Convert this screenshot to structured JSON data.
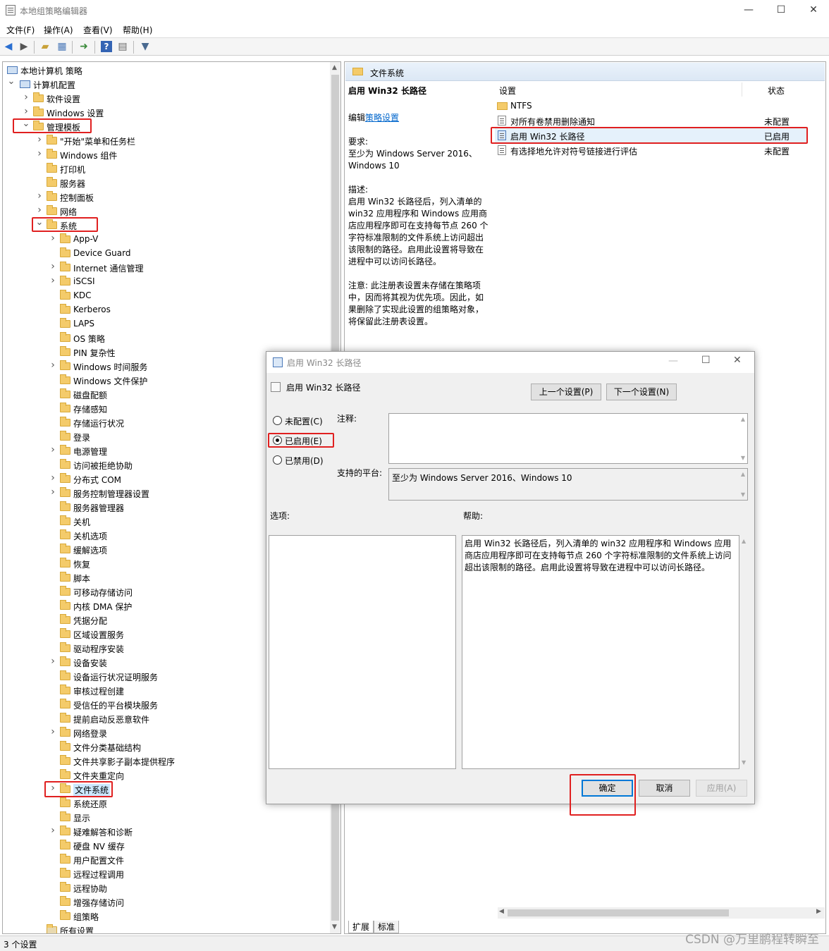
{
  "window": {
    "title": "本地组策略编辑器",
    "min": "—",
    "max": "☐",
    "close": "✕"
  },
  "menu": [
    "文件(F)",
    "操作(A)",
    "查看(V)",
    "帮助(H)"
  ],
  "toolbar_icons": [
    "back-icon",
    "forward-icon",
    "up-folder-icon",
    "show-hide-tree-icon",
    "export-list-icon",
    "help-icon",
    "properties-icon",
    "filter-icon"
  ],
  "tree": [
    {
      "label": "本地计算机 策略",
      "level": 0,
      "arrow": "",
      "icon": "computer"
    },
    {
      "label": "计算机配置",
      "level": 0,
      "arrow": "v",
      "icon": "computer",
      "indent": 1
    },
    {
      "label": "软件设置",
      "level": 2,
      "arrow": ">"
    },
    {
      "label": "Windows 设置",
      "level": 2,
      "arrow": ">"
    },
    {
      "label": "管理模板",
      "level": 2,
      "arrow": "v",
      "hl": true
    },
    {
      "label": "\"开始\"菜单和任务栏",
      "level": 3,
      "arrow": ">"
    },
    {
      "label": "Windows 组件",
      "level": 3,
      "arrow": ">"
    },
    {
      "label": "打印机",
      "level": 3,
      "arrow": ""
    },
    {
      "label": "服务器",
      "level": 3,
      "arrow": ""
    },
    {
      "label": "控制面板",
      "level": 3,
      "arrow": ">"
    },
    {
      "label": "网络",
      "level": 3,
      "arrow": ">"
    },
    {
      "label": "系统",
      "level": 3,
      "arrow": "v",
      "hl": true
    },
    {
      "label": "App-V",
      "level": 4,
      "arrow": ">"
    },
    {
      "label": "Device Guard",
      "level": 4,
      "arrow": ""
    },
    {
      "label": "Internet 通信管理",
      "level": 4,
      "arrow": ">"
    },
    {
      "label": "iSCSI",
      "level": 4,
      "arrow": ">"
    },
    {
      "label": "KDC",
      "level": 4,
      "arrow": ""
    },
    {
      "label": "Kerberos",
      "level": 4,
      "arrow": ""
    },
    {
      "label": "LAPS",
      "level": 4,
      "arrow": ""
    },
    {
      "label": "OS 策略",
      "level": 4,
      "arrow": ""
    },
    {
      "label": "PIN 复杂性",
      "level": 4,
      "arrow": ""
    },
    {
      "label": "Windows 时间服务",
      "level": 4,
      "arrow": ">"
    },
    {
      "label": "Windows 文件保护",
      "level": 4,
      "arrow": ""
    },
    {
      "label": "磁盘配额",
      "level": 4,
      "arrow": ""
    },
    {
      "label": "存储感知",
      "level": 4,
      "arrow": ""
    },
    {
      "label": "存储运行状况",
      "level": 4,
      "arrow": ""
    },
    {
      "label": "登录",
      "level": 4,
      "arrow": ""
    },
    {
      "label": "电源管理",
      "level": 4,
      "arrow": ">"
    },
    {
      "label": "访问被拒绝协助",
      "level": 4,
      "arrow": ""
    },
    {
      "label": "分布式 COM",
      "level": 4,
      "arrow": ">"
    },
    {
      "label": "服务控制管理器设置",
      "level": 4,
      "arrow": ">"
    },
    {
      "label": "服务器管理器",
      "level": 4,
      "arrow": ""
    },
    {
      "label": "关机",
      "level": 4,
      "arrow": ""
    },
    {
      "label": "关机选项",
      "level": 4,
      "arrow": ""
    },
    {
      "label": "缓解选项",
      "level": 4,
      "arrow": ""
    },
    {
      "label": "恢复",
      "level": 4,
      "arrow": ""
    },
    {
      "label": "脚本",
      "level": 4,
      "arrow": ""
    },
    {
      "label": "可移动存储访问",
      "level": 4,
      "arrow": ""
    },
    {
      "label": "内核 DMA 保护",
      "level": 4,
      "arrow": ""
    },
    {
      "label": "凭据分配",
      "level": 4,
      "arrow": ""
    },
    {
      "label": "区域设置服务",
      "level": 4,
      "arrow": ""
    },
    {
      "label": "驱动程序安装",
      "level": 4,
      "arrow": ""
    },
    {
      "label": "设备安装",
      "level": 4,
      "arrow": ">"
    },
    {
      "label": "设备运行状况证明服务",
      "level": 4,
      "arrow": ""
    },
    {
      "label": "审核过程创建",
      "level": 4,
      "arrow": ""
    },
    {
      "label": "受信任的平台模块服务",
      "level": 4,
      "arrow": ""
    },
    {
      "label": "提前启动反恶意软件",
      "level": 4,
      "arrow": ""
    },
    {
      "label": "网络登录",
      "level": 4,
      "arrow": ">"
    },
    {
      "label": "文件分类基础结构",
      "level": 4,
      "arrow": ""
    },
    {
      "label": "文件共享影子副本提供程序",
      "level": 4,
      "arrow": ""
    },
    {
      "label": "文件夹重定向",
      "level": 4,
      "arrow": ""
    },
    {
      "label": "文件系统",
      "level": 4,
      "arrow": ">",
      "hl": true,
      "selected": true
    },
    {
      "label": "系统还原",
      "level": 4,
      "arrow": ""
    },
    {
      "label": "显示",
      "level": 4,
      "arrow": ""
    },
    {
      "label": "疑难解答和诊断",
      "level": 4,
      "arrow": ">"
    },
    {
      "label": "硬盘 NV 缓存",
      "level": 4,
      "arrow": ""
    },
    {
      "label": "用户配置文件",
      "level": 4,
      "arrow": ""
    },
    {
      "label": "远程过程调用",
      "level": 4,
      "arrow": ""
    },
    {
      "label": "远程协助",
      "level": 4,
      "arrow": ""
    },
    {
      "label": "增强存储访问",
      "level": 4,
      "arrow": ""
    },
    {
      "label": "组策略",
      "level": 4,
      "arrow": ""
    },
    {
      "label": "所有设置",
      "level": 3,
      "arrow": "",
      "icon": "settings"
    }
  ],
  "right": {
    "header": "文件系统",
    "policy_title": "启用 Win32 长路径",
    "edit_prefix": "编辑",
    "edit_link": "策略设置",
    "requirements_label": "要求:",
    "requirements": [
      "至少为 Windows Server 2016、",
      "Windows 10"
    ],
    "description_label": "描述:",
    "description": [
      "启用 Win32 长路径后，列入清单的",
      "win32 应用程序和 Windows 应用商",
      "店应用程序即可在支持每节点 260 个",
      "字符标准限制的文件系统上访问超出",
      "该限制的路径。启用此设置将导致在",
      "进程中可以访问长路径。"
    ],
    "note": [
      "注意: 此注册表设置未存储在策略项",
      "中，因而将其视为优先项。因此，如",
      "果删除了实现此设置的组策略对象，",
      "将保留此注册表设置。"
    ],
    "col_setting": "设置",
    "col_state": "状态",
    "rows": [
      {
        "name": "NTFS",
        "state": "",
        "type": "folder"
      },
      {
        "name": "对所有卷禁用删除通知",
        "state": "未配置",
        "type": "doc"
      },
      {
        "name": "启用 Win32 长路径",
        "state": "已启用",
        "type": "doc",
        "hl": true
      },
      {
        "name": "有选择地允许对符号链接进行评估",
        "state": "未配置",
        "type": "doc"
      }
    ],
    "tabs": [
      "扩展",
      "标准"
    ]
  },
  "dialog": {
    "title": "启用 Win32 长路径",
    "heading": "启用 Win32 长路径",
    "prev": "上一个设置(P)",
    "next": "下一个设置(N)",
    "radio_not_configured": "未配置(C)",
    "radio_enabled": "已启用(E)",
    "radio_disabled": "已禁用(D)",
    "comment_label": "注释:",
    "platform_label": "支持的平台:",
    "platform_value": "至少为 Windows Server 2016、Windows 10",
    "options_label": "选项:",
    "help_label": "帮助:",
    "help_lines": [
      "启用 Win32 长路径后，列入清单的 win32 应用程序和 Windows 应用",
      "商店应用程序即可在支持每节点 260 个字符标准限制的文件系统上访问",
      "超出该限制的路径。启用此设置将导致在进程中可以访问长路径。"
    ],
    "ok": "确定",
    "cancel": "取消",
    "apply": "应用(A)"
  },
  "status": "3 个设置",
  "watermark": "CSDN @万里鹏程转瞬至",
  "colors": {
    "highlight_red": "#e02020",
    "link": "#0066cc",
    "selected": "#cce8ff"
  }
}
